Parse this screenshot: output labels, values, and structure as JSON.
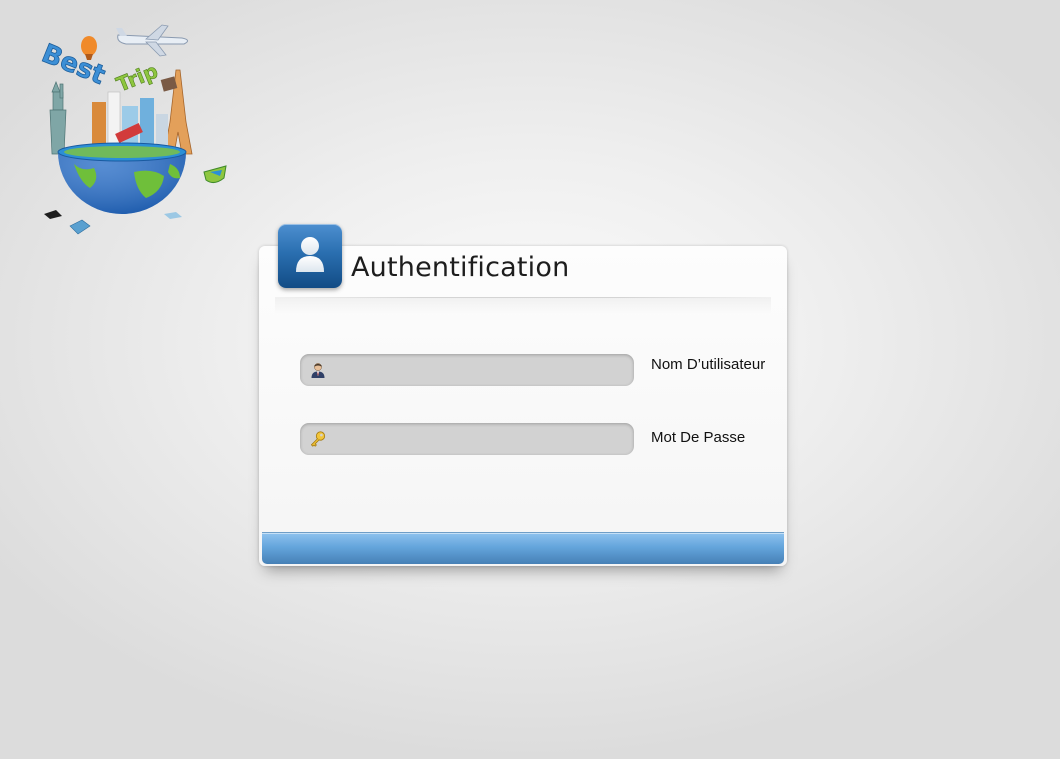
{
  "brand": {
    "logo_text_line1": "Best",
    "logo_text_line2": "Trip",
    "logo_icon": "globe-travel-logo"
  },
  "login": {
    "title": "Authentification",
    "badge_icon": "user-icon",
    "username": {
      "label": "Nom D’utilisateur",
      "value": "",
      "placeholder": "",
      "icon": "person-icon"
    },
    "password": {
      "label": "Mot De Passe",
      "value": "",
      "placeholder": "",
      "icon": "key-icon"
    },
    "submit_label": ""
  },
  "colors": {
    "accent_blue": "#2a6fb0",
    "submit_bar": "#64a5dc",
    "field_bg": "#d2d2d2"
  }
}
